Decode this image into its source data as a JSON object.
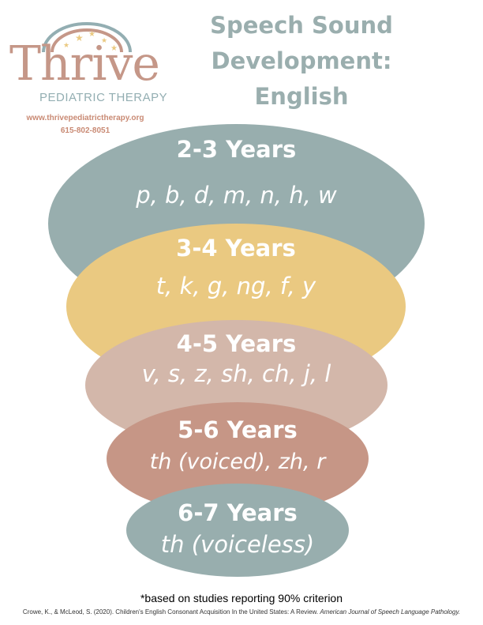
{
  "logo": {
    "brand": "Thrive",
    "tagline": "PEDIATRIC THERAPY",
    "website": "www.thrivepediatrictherapy.org",
    "phone": "615-802-8051",
    "colors": {
      "brand": "#c59788",
      "tagline": "#93aeb2",
      "contact": "#c98a74",
      "rainbow_outer": "#93aeb2",
      "rainbow_mid": "#c59788",
      "stars": "#eac981"
    }
  },
  "title": {
    "line1": "Speech Sound",
    "line2": "Development:",
    "line3": "English",
    "color": "#9aaeae"
  },
  "layers": [
    {
      "age": "2-3 Years",
      "sounds": "p, b, d, m, n, h, w",
      "color": "#98aeae"
    },
    {
      "age": "3-4 Years",
      "sounds": "t, k, g, ng, f, y",
      "color": "#eac981"
    },
    {
      "age": "4-5 Years",
      "sounds": "v, s, z, sh, ch, j, l",
      "color": "#d3b7aa"
    },
    {
      "age": "5-6 Years",
      "sounds": "th (voiced), zh, r",
      "color": "#c69686"
    },
    {
      "age": "6-7 Years",
      "sounds": "th (voiceless)",
      "color": "#98aeae"
    }
  ],
  "footer": {
    "note": "*based on studies reporting 90% criterion",
    "citation_main": "Crowe, K., & McLeod, S. (2020). Children's English Consonant Acquisition In the United States: A Review.",
    "citation_journal": "American Journal of Speech Language Pathology."
  }
}
